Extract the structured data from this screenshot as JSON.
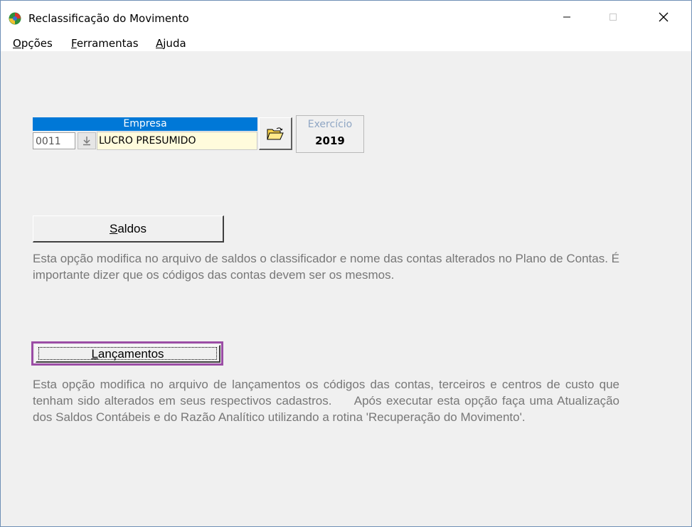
{
  "window": {
    "title": "Reclassificação do Movimento",
    "controls": {
      "minimize": "minimize",
      "maximize": "maximize",
      "close": "close"
    }
  },
  "menu": {
    "items": [
      {
        "accel": "O",
        "rest": "pções"
      },
      {
        "accel": "F",
        "rest": "erramentas"
      },
      {
        "accel": "A",
        "rest": "juda"
      }
    ]
  },
  "empresa": {
    "header": "Empresa",
    "code": "0011",
    "name": "LUCRO PRESUMIDO"
  },
  "exercicio": {
    "label": "Exercício",
    "value": "2019"
  },
  "saldos": {
    "accel": "S",
    "rest": "aldos",
    "description": "Esta opção modifica no arquivo de saldos o classificador e nome das contas alterados no Plano de Contas. É importante dizer que os códigos das contas devem ser os mesmos."
  },
  "lancamentos": {
    "accel": "L",
    "rest": "ançamentos",
    "description": "Esta opção modifica no arquivo de lançamentos os códigos das contas, terceiros e centros de custo que tenham sido alterados em seus respectivos cadastros.     Após executar esta opção faça uma Atualização dos Saldos Contábeis e do Razão Analítico utilizando a rotina 'Recuperação do Movimento'."
  },
  "colors": {
    "header_blue": "#0078d7",
    "focus_purple": "#9b4da5",
    "name_field_bg": "#fffbdc",
    "description_gray": "#777777"
  }
}
